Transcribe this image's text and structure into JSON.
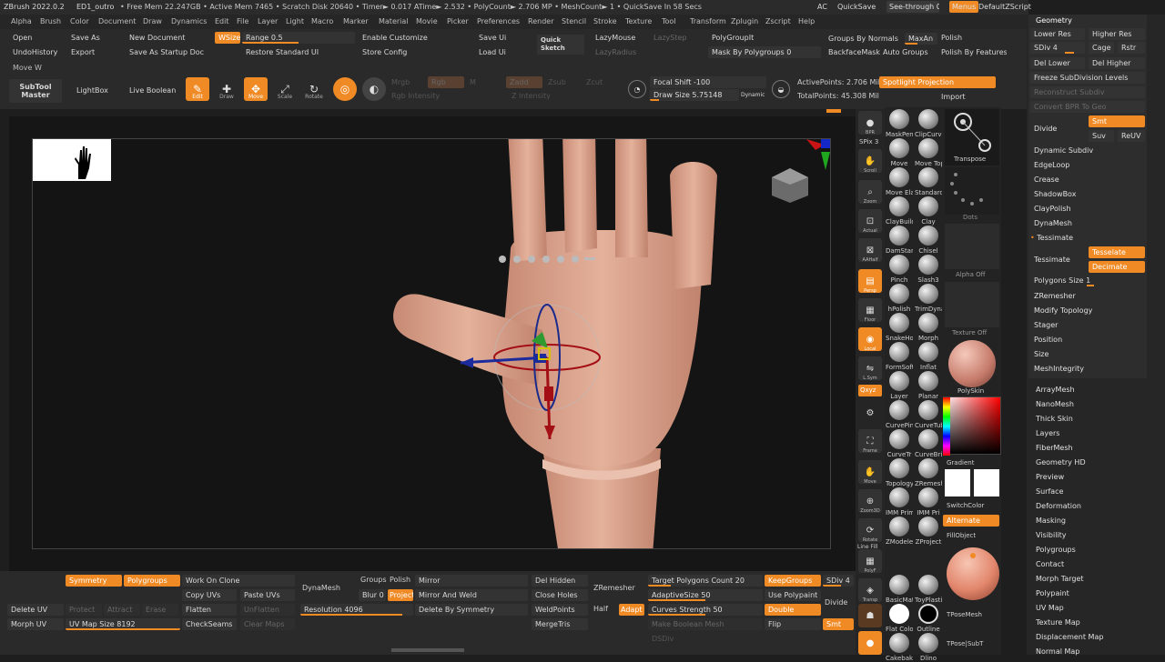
{
  "titlebar": {
    "app": "ZBrush 2022.0.2",
    "doc": "ED1_outro",
    "stats": "• Free Mem 22.247GB • Active Mem 7465 • Scratch Disk 20640 • Timer► 0.017 ATime► 2.532 • PolyCount► 2.706 MP • MeshCount► 1 • QuickSave In 58 Secs",
    "ac": "AC",
    "quicksave": "QuickSave",
    "seethrough": "See-through",
    "seethrough_val": "0",
    "menus": "Menus",
    "script": "DefaultZScript"
  },
  "menubar": [
    "Alpha",
    "Brush",
    "Color",
    "Document",
    "Draw",
    "Dynamics",
    "Edit",
    "File",
    "Layer",
    "Light",
    "Macro",
    "Marker",
    "Material",
    "Movie",
    "Picker",
    "Preferences",
    "Render",
    "Stencil",
    "Stroke",
    "Texture",
    "Tool",
    "Transform",
    "Zplugin",
    "Zscript",
    "Help"
  ],
  "shelf1": {
    "open": "Open",
    "save_as": "Save As",
    "new_doc": "New Document",
    "wsize": "WSize",
    "range": "Range 0.5",
    "enable_customize": "Enable Customize",
    "save_ui": "Save Ui",
    "quick_sketch": "Quick Sketch",
    "lazymouse": "LazyMouse",
    "lazystep": "LazyStep",
    "polygroupit": "PolyGroupIt",
    "groups_by_normals": "Groups By Normals",
    "maxang": "MaxAn",
    "polish": "Polish",
    "undohistory": "UndoHistory",
    "export": "Export",
    "save_startup": "Save As Startup Doc",
    "restore_ui": "Restore Standard UI",
    "store_config": "Store Config",
    "load_ui": "Load Ui",
    "lazyradius": "LazyRadius",
    "mask_by_pg": "Mask By Polygroups 0",
    "backface": "BackfaceMask",
    "auto_groups": "Auto Groups",
    "polish_features": "Polish By Features",
    "move_w": "Move W"
  },
  "shelf2": {
    "subtool_master": "SubTool Master",
    "lightbox": "LightBox",
    "live_boolean": "Live Boolean",
    "edit": "Edit",
    "draw": "Draw",
    "move": "Move",
    "scale": "Scale",
    "rotate": "Rotate",
    "mrgb": "Mrgb",
    "rgb": "Rgb",
    "m": "M",
    "zadd": "Zadd",
    "zsub": "Zsub",
    "zcut": "Zcut",
    "rgb_intensity": "Rgb Intensity",
    "z_intensity": "Z Intensity",
    "focal_shift": "Focal Shift -100",
    "draw_size": "Draw Size 5.75148",
    "dynamic": "Dynamic",
    "active_points": "ActivePoints: 2.706 Mil",
    "total_points": "TotalPoints: 45.308 Mil",
    "spotlight": "Spotlight Projection",
    "import": "Import"
  },
  "toolbar_icons": {
    "bpr": "BPR",
    "spix": "SPix 3",
    "scroll": "Scroll",
    "zoom": "Zoom",
    "actual": "Actual",
    "aahalf": "AAHalf",
    "persp": "Persp",
    "floor": "Floor",
    "local": "Local",
    "lsym": "L.Sym",
    "qxyz": "Qxyz",
    "frame": "Frame",
    "move": "Move",
    "zoom3d": "Zoom3D",
    "rotate": "Rotate",
    "linefill": "Line Fill",
    "polyf": "PolyF",
    "transp": "Transp",
    "solo": "Solo"
  },
  "brushes": [
    [
      "MaskPen",
      "ClipCurve"
    ],
    [
      "Move",
      "Move Topo"
    ],
    [
      "Move Elastic",
      "Standard"
    ],
    [
      "ClayBuild",
      "Clay"
    ],
    [
      "DamStandard",
      "Chisel"
    ],
    [
      "Pinch",
      "Slash3"
    ],
    [
      "hPolish",
      "TrimDynamic"
    ],
    [
      "SnakeHook",
      "Morph"
    ],
    [
      "FormSoft",
      "Inflat"
    ],
    [
      "Layer",
      "Planar"
    ],
    [
      "CurvePinch",
      "CurveTube"
    ],
    [
      "CurveTr",
      "CurveBridge"
    ],
    [
      "Topology",
      "ZRemesher"
    ],
    [
      "IMM Primitives",
      "IMM Pri"
    ],
    [
      "ZModeler",
      "ZProject"
    ],
    [
      "BasicMaterial",
      "ToyPlastic"
    ],
    [
      "Flat Color",
      "Outline"
    ],
    [
      "Cakebake",
      "Dlino"
    ]
  ],
  "palette": {
    "transpose": "Transpose",
    "dots": "Dots",
    "alpha_off": "Alpha Off",
    "texture_off": "Texture Off",
    "polyskin": "PolySkin",
    "gradient": "Gradient",
    "switchcolor": "SwitchColor",
    "alternate": "Alternate",
    "fillobject": "FillObject",
    "tposemesh": "TPoseMesh",
    "tpose_subt": "TPose|SubT"
  },
  "geometry": {
    "title": "Geometry",
    "lower_res": "Lower Res",
    "higher_res": "Higher Res",
    "sdiv": "SDiv 4",
    "cage": "Cage",
    "rstr": "Rstr",
    "del_lower": "Del Lower",
    "del_higher": "Del Higher",
    "freeze": "Freeze SubDivision Levels",
    "reconstruct": "Reconstruct Subdiv",
    "convert_bpr": "Convert BPR To Geo",
    "divide": "Divide",
    "smt": "Smt",
    "suv": "Suv",
    "reuv": "ReUV",
    "dynamic_subdiv": "Dynamic Subdiv",
    "edgeloop": "EdgeLoop",
    "crease": "Crease",
    "shadowbox": "ShadowBox",
    "claypolish": "ClayPolish",
    "dynamesh": "DynaMesh",
    "tessimate_header": "Tessimate",
    "tessimate": "Tessimate",
    "tesselate": "Tesselate",
    "decimate": "Decimate",
    "polygons_size": "Polygons Size 1",
    "zremesher": "ZRemesher",
    "modify_topology": "Modify Topology",
    "stager": "Stager",
    "position": "Position",
    "size": "Size",
    "meshintegrity": "MeshIntegrity"
  },
  "tool_menu": [
    "ArrayMesh",
    "NanoMesh",
    "Thick Skin",
    "Layers",
    "FiberMesh",
    "Geometry HD",
    "Preview",
    "Surface",
    "Deformation",
    "Masking",
    "Visibility",
    "Polygroups",
    "Contact",
    "Morph Target",
    "Polypaint",
    "UV Map",
    "Texture Map",
    "Displacement Map",
    "Normal Map"
  ],
  "bottom": {
    "symmetry": "Symmetry",
    "polygroups": "Polygroups",
    "work_on_clone": "Work On Clone",
    "copy_uvs": "Copy UVs",
    "paste_uvs": "Paste UVs",
    "flatten": "Flatten",
    "unflatten": "UnFlatten",
    "checkseams": "CheckSeams",
    "clear_maps": "Clear Maps",
    "delete_uv": "Delete UV",
    "protect": "Protect",
    "attract": "Attract",
    "erase": "Erase",
    "morph_uv": "Morph UV",
    "uv_map_size": "UV Map Size 8192",
    "dynamesh": "DynaMesh",
    "groups": "Groups",
    "polish": "Polish",
    "blur": "Blur 0",
    "project": "Project",
    "resolution": "Resolution 4096",
    "mirror": "Mirror",
    "mirror_weld": "Mirror And Weld",
    "delete_by_symmetry": "Delete By Symmetry",
    "del_hidden": "Del Hidden",
    "close_holes": "Close Holes",
    "weldpoints": "WeldPoints",
    "mergetris": "MergeTris",
    "zremesher": "ZRemesher",
    "half": "Half",
    "adapt": "Adapt",
    "target_polygons": "Target Polygons Count 20",
    "adaptive_size": "AdaptiveSize 50",
    "curves_strength": "Curves Strength 50",
    "make_boolean": "Make Boolean Mesh",
    "dsdiv": "DSDiv",
    "keepgroups": "KeepGroups",
    "use_polypaint": "Use Polypaint",
    "double": "Double",
    "flip": "Flip",
    "sdiv": "SDiv 4",
    "divide": "Divide",
    "smt": "Smt"
  },
  "colors": {
    "accent": "#f08a24",
    "panel": "#2a2a2a",
    "skin": "#d9a088"
  }
}
